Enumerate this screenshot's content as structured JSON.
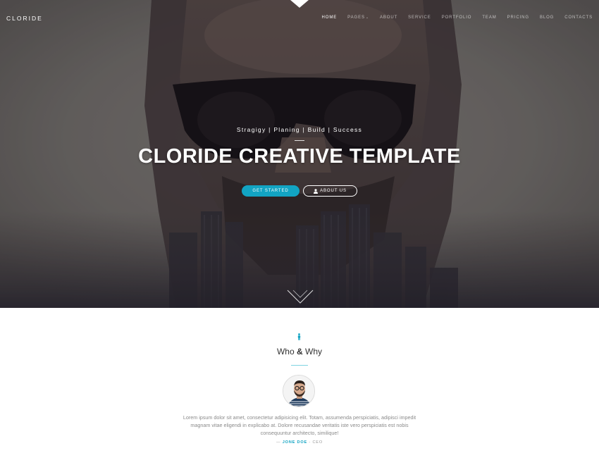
{
  "brand": {
    "logo": "CLORIDE"
  },
  "nav": {
    "items": [
      {
        "label": "HOME",
        "active": true
      },
      {
        "label": "PAGES",
        "dropdown": true
      },
      {
        "label": "ABOUT"
      },
      {
        "label": "SERVICE"
      },
      {
        "label": "PORTFOLIO"
      },
      {
        "label": "TEAM"
      },
      {
        "label": "PRICING"
      },
      {
        "label": "BLOG"
      },
      {
        "label": "CONTACTS"
      }
    ],
    "caret_icon": "chevron-down-icon"
  },
  "hero": {
    "tagline": "Stragigy | Planing | Build | Success",
    "title": "CLORIDE CREATIVE TEMPLATE",
    "primary_button": "GET STARTED",
    "secondary_button": "ABOUT US",
    "secondary_button_icon": "user-icon",
    "scroll_icon": "chevron-down-icon"
  },
  "about": {
    "icon": "person-icon",
    "title_left": "Who ",
    "title_amp": "&",
    "title_right": " Why",
    "quote": "Lorem ipsum dolor sit amet, consectetur adipisicing elit. Totam, assumenda perspiciatis, adipisci impedit magnam vitae eligendi in explicabo at. Dolore recusandae veritatis iste vero perspiciatis est nobis consequuntur architecto, similique!",
    "author_prefix": "— ",
    "author_name": "JONE DOE",
    "author_suffix": " - CEO"
  },
  "colors": {
    "accent": "#12a4c3",
    "hero_dark": "#2a2628",
    "text_muted": "#8a8a8a"
  }
}
